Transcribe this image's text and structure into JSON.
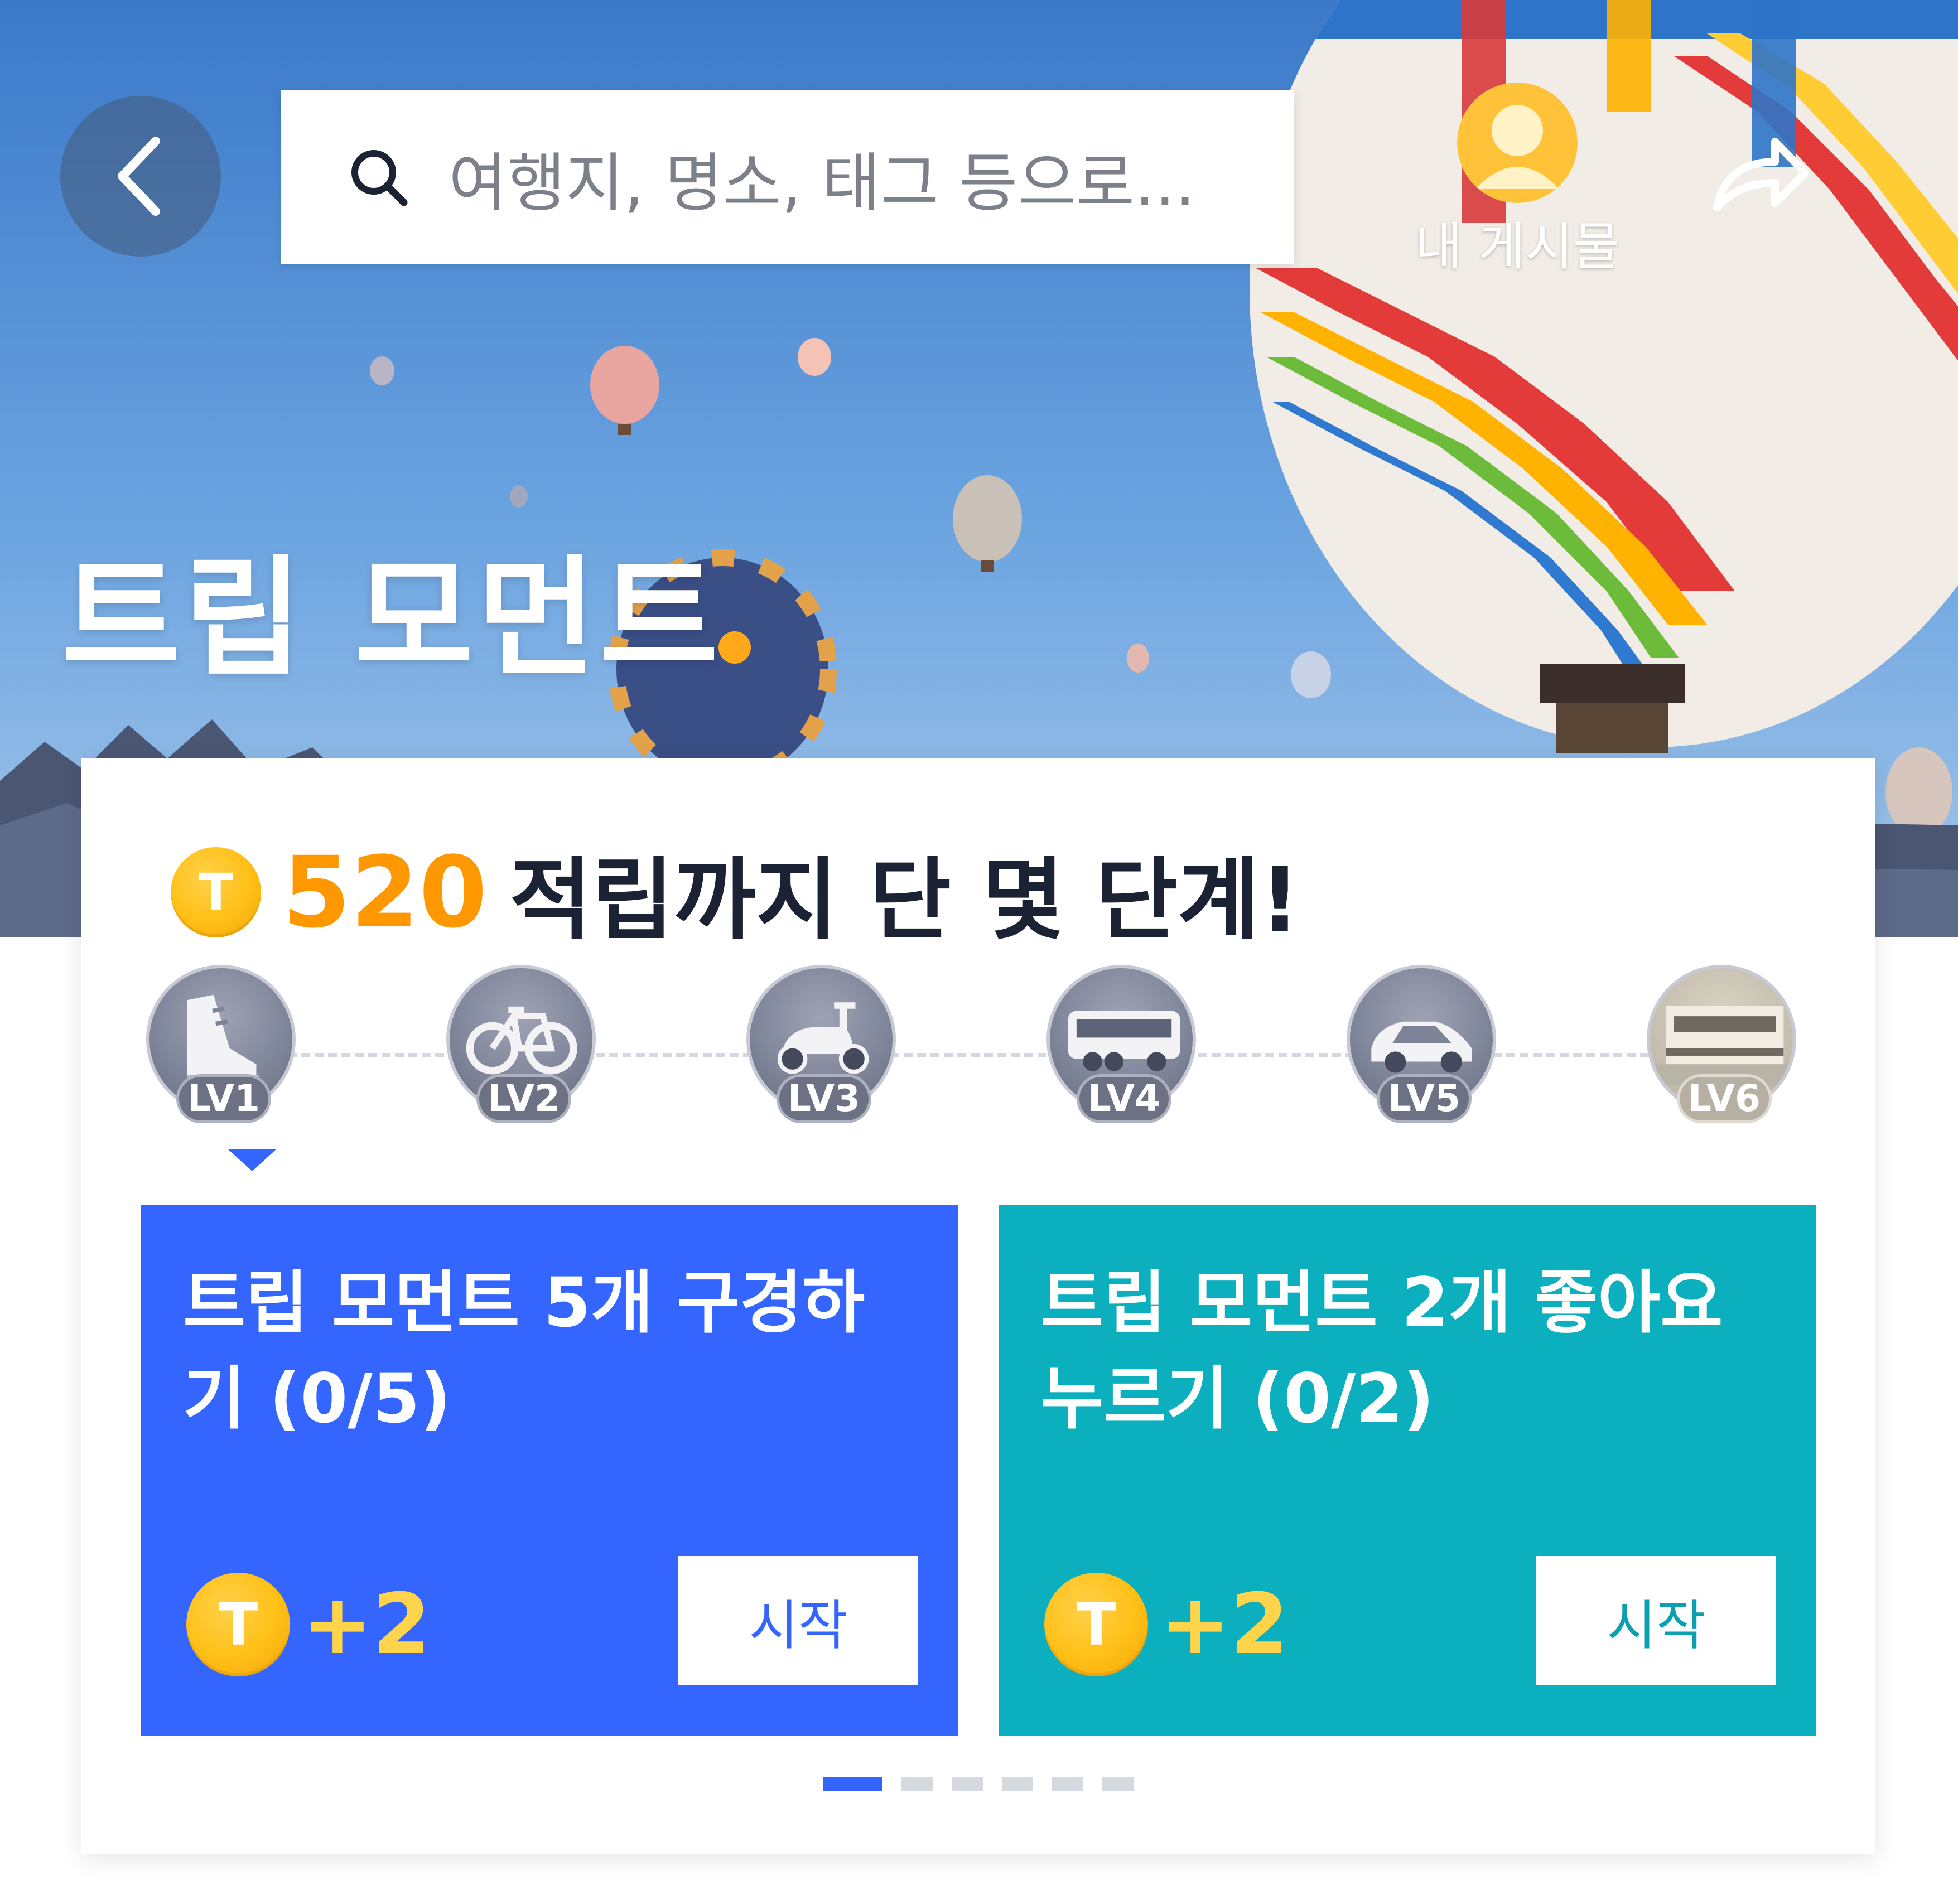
{
  "header": {
    "search_placeholder": "여행지, 명소, 태그 등으로...",
    "my_posts_label": "내 게시물",
    "icons": {
      "back": "chevron-left-icon",
      "search": "search-icon",
      "avatar": "user-avatar-icon",
      "share": "share-arrow-icon"
    }
  },
  "hero": {
    "title": "트립 모먼트",
    "accent_color": "#ffa91a"
  },
  "reward_banner": {
    "coin_symbol": "T",
    "points": "520",
    "text": "적립까지 단 몇 단계!"
  },
  "levels": [
    {
      "label": "LV1",
      "icon": "shoe-icon",
      "current": true
    },
    {
      "label": "LV2",
      "icon": "bicycle-icon",
      "current": false
    },
    {
      "label": "LV3",
      "icon": "scooter-icon",
      "current": false
    },
    {
      "label": "LV4",
      "icon": "bus-icon",
      "current": false
    },
    {
      "label": "LV5",
      "icon": "car-icon",
      "current": false
    },
    {
      "label": "LV6",
      "icon": "train-icon",
      "current": false
    }
  ],
  "missions": [
    {
      "text": "트립 모먼트 5개 구경하기 (0/5)",
      "coin_symbol": "T",
      "reward": "+2",
      "button": "시작",
      "color": "#3565ff"
    },
    {
      "text": "트립 모먼트 2개 좋아요 누르기 (0/2)",
      "coin_symbol": "T",
      "reward": "+2",
      "button": "시작",
      "color": "#0bafbe"
    }
  ],
  "pager": {
    "total": 6,
    "active_index": 0
  },
  "colors": {
    "primary": "#3565ff",
    "teal": "#0bafbe",
    "coin": "#ffbf16",
    "points": "#ff9800"
  }
}
